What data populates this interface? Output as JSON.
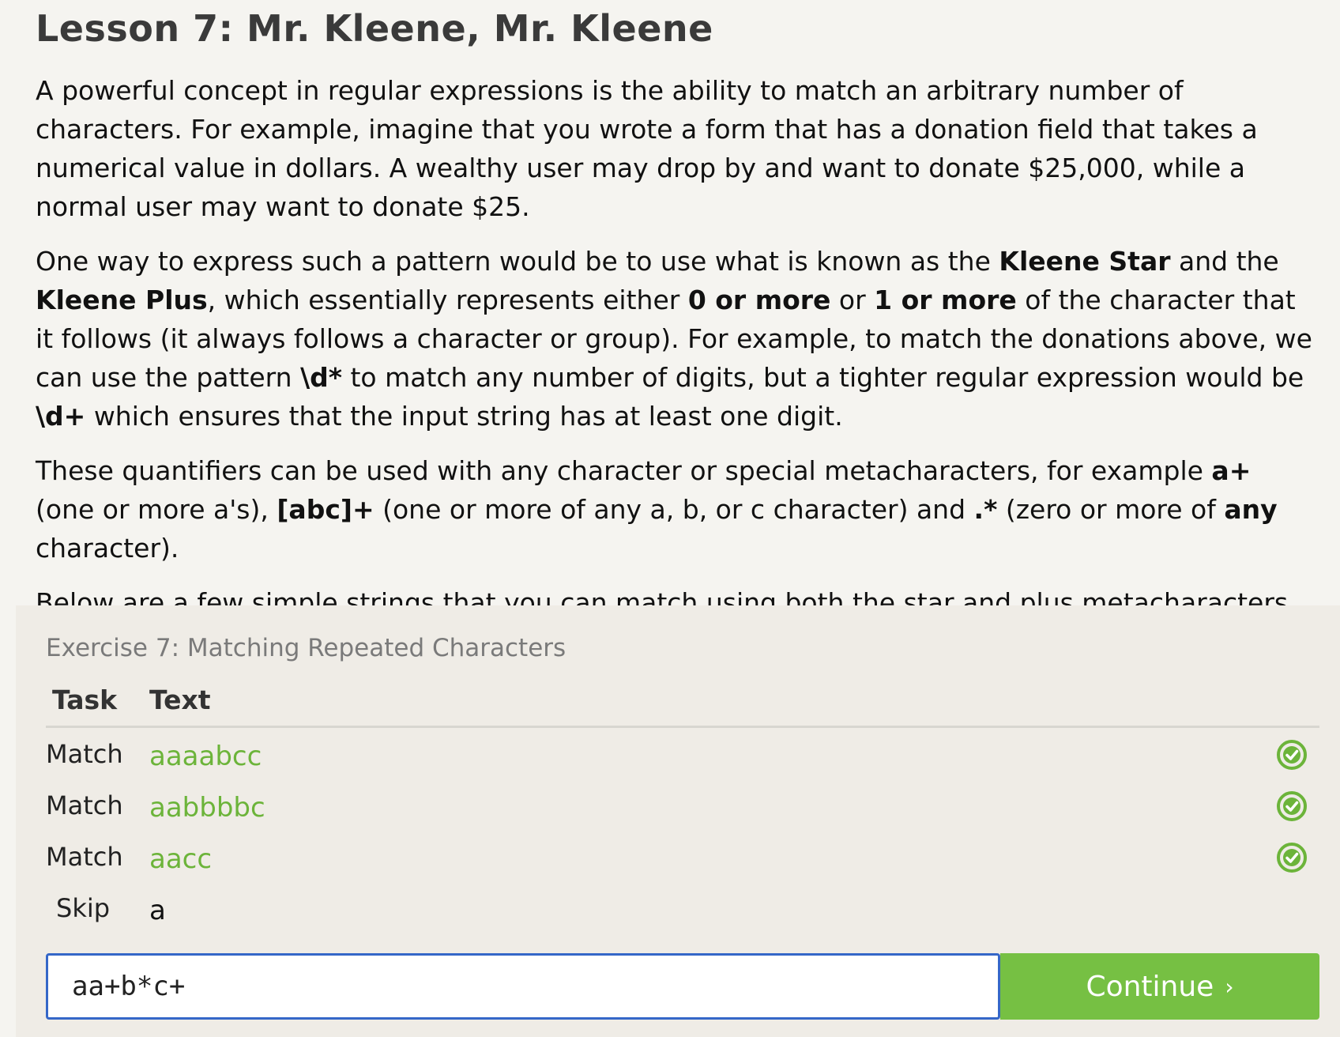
{
  "lesson": {
    "title": "Lesson 7: Mr. Kleene, Mr. Kleene",
    "paragraphs": [
      [
        {
          "t": "A powerful concept in regular expressions is the ability to match an arbitrary number of characters. For example, imagine that you wrote a form that has a donation field that takes a numerical value in dollars. A wealthy user may drop by and want to donate $25,000, while a normal user may want to donate $25.",
          "b": false
        }
      ],
      [
        {
          "t": "One way to express such a pattern would be to use what is known as the ",
          "b": false
        },
        {
          "t": "Kleene Star",
          "b": true
        },
        {
          "t": " and the ",
          "b": false
        },
        {
          "t": "Kleene Plus",
          "b": true
        },
        {
          "t": ", which essentially represents either ",
          "b": false
        },
        {
          "t": "0 or more",
          "b": true
        },
        {
          "t": " or ",
          "b": false
        },
        {
          "t": "1 or more",
          "b": true
        },
        {
          "t": " of the character that it follows (it always follows a character or group). For example, to match the donations above, we can use the pattern ",
          "b": false
        },
        {
          "t": "\\d*",
          "b": true
        },
        {
          "t": " to match any number of digits, but a tighter regular expression would be ",
          "b": false
        },
        {
          "t": "\\d+",
          "b": true
        },
        {
          "t": " which ensures that the input string has at least one digit.",
          "b": false
        }
      ],
      [
        {
          "t": "These quantifiers can be used with any character or special metacharacters, for example ",
          "b": false
        },
        {
          "t": "a+",
          "b": true
        },
        {
          "t": " (one or more a's), ",
          "b": false
        },
        {
          "t": "[abc]+",
          "b": true
        },
        {
          "t": " (one or more of any a, b, or c character) and ",
          "b": false
        },
        {
          "t": ".*",
          "b": true
        },
        {
          "t": " (zero or more of ",
          "b": false
        },
        {
          "t": "any",
          "b": true
        },
        {
          "t": " character).",
          "b": false
        }
      ],
      [
        {
          "t": "Below are a few simple strings that you can match using both the star and plus metacharacters.",
          "b": false
        }
      ]
    ]
  },
  "exercise": {
    "title": "Exercise 7: Matching Repeated Characters",
    "headers": {
      "task": "Task",
      "text": "Text"
    },
    "rows": [
      {
        "task": "Match",
        "text": "aaaabcc",
        "status": "matched"
      },
      {
        "task": "Match",
        "text": "aabbbbc",
        "status": "matched"
      },
      {
        "task": "Match",
        "text": "aacc",
        "status": "matched"
      },
      {
        "task": "Skip",
        "text": "a",
        "status": "none"
      }
    ],
    "input_value": "aa+b*c+",
    "continue_label": "Continue",
    "continue_chevron": "›"
  },
  "colors": {
    "match_green": "#6cb43a",
    "button_green": "#76c043",
    "input_border": "#3567c8"
  },
  "icons": {
    "check": "check-circle-icon"
  }
}
